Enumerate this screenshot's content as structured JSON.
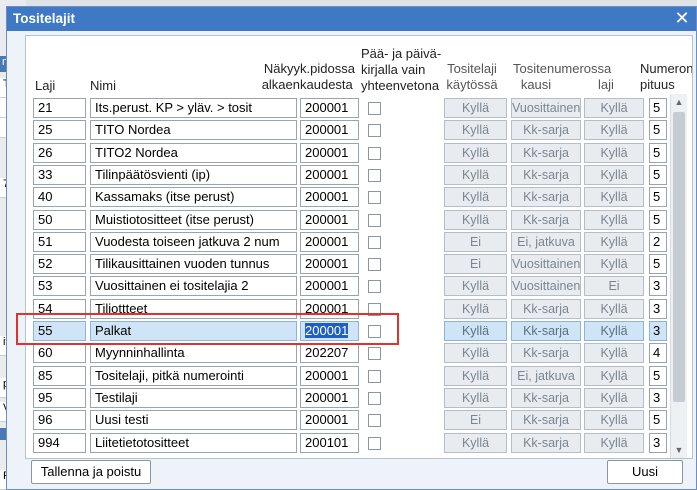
{
  "background": {
    "fragments": [
      "ma",
      "T",
      "7",
      "ito",
      "pä",
      "V",
      "Ra"
    ]
  },
  "dialog": {
    "title": "Tositelajit",
    "close_glyph": "✕"
  },
  "headers": {
    "laji": "Laji",
    "nimi": "Nimi",
    "nakyy": [
      "Näkyy",
      "alkaen"
    ],
    "kp": [
      "k.pidossa",
      "kaudesta"
    ],
    "paa": [
      "Pää- ja päivä-",
      "kirjalla vain",
      "yhteenvetona"
    ],
    "tositelaji": [
      "Tositelaji",
      "käytössä"
    ],
    "tositenumerossa": "Tositenumerossa",
    "kausi": "kausi",
    "laji2": "laji",
    "numeron": [
      "Numeron",
      "pituus"
    ]
  },
  "rows": [
    {
      "laji": "21",
      "nimi": "Its.perust. KP > yläv. > tosit",
      "kp": "200001",
      "kaytossa": "Kyllä",
      "kausi": "Vuosittainen",
      "laji2": "Kyllä",
      "pituus": "5"
    },
    {
      "laji": "25",
      "nimi": "TITO Nordea",
      "kp": "200001",
      "kaytossa": "Kyllä",
      "kausi": "Kk-sarja",
      "laji2": "Kyllä",
      "pituus": "5"
    },
    {
      "laji": "26",
      "nimi": "TITO2 Nordea",
      "kp": "200001",
      "kaytossa": "Kyllä",
      "kausi": "Kk-sarja",
      "laji2": "Kyllä",
      "pituus": "5"
    },
    {
      "laji": "33",
      "nimi": "Tilinpäätösvienti (ip)",
      "kp": "200001",
      "kaytossa": "Kyllä",
      "kausi": "Kk-sarja",
      "laji2": "Kyllä",
      "pituus": "5"
    },
    {
      "laji": "40",
      "nimi": "Kassamaks (itse perust)",
      "kp": "200001",
      "kaytossa": "Kyllä",
      "kausi": "Kk-sarja",
      "laji2": "Kyllä",
      "pituus": "5"
    },
    {
      "laji": "50",
      "nimi": "Muistiotositteet (itse perust)",
      "kp": "200001",
      "kaytossa": "Kyllä",
      "kausi": "Kk-sarja",
      "laji2": "Kyllä",
      "pituus": "5"
    },
    {
      "laji": "51",
      "nimi": "Vuodesta toiseen jatkuva 2 num",
      "kp": "200001",
      "kaytossa": "Ei",
      "kausi": "Ei, jatkuva",
      "laji2": "Kyllä",
      "pituus": "2"
    },
    {
      "laji": "52",
      "nimi": "Tilikausittainen vuoden tunnus",
      "kp": "200001",
      "kaytossa": "Ei",
      "kausi": "Vuosittainen",
      "laji2": "Kyllä",
      "pituus": "5"
    },
    {
      "laji": "53",
      "nimi": "Vuosittainen ei tositelajia 2",
      "kp": "200001",
      "kaytossa": "Kyllä",
      "kausi": "Vuosittainen",
      "laji2": "Ei",
      "pituus": "3"
    },
    {
      "laji": "54",
      "nimi": "Tiliottteet",
      "kp": "200001",
      "kaytossa": "Kyllä",
      "kausi": "Kk-sarja",
      "laji2": "Kyllä",
      "pituus": "3"
    },
    {
      "laji": "55",
      "nimi": "Palkat",
      "kp": "200001",
      "kaytossa": "Kyllä",
      "kausi": "Kk-sarja",
      "laji2": "Kyllä",
      "pituus": "3",
      "selected": true
    },
    {
      "laji": "60",
      "nimi": "Myynninhallinta",
      "kp": "202207",
      "kaytossa": "Kyllä",
      "kausi": "Kk-sarja",
      "laji2": "Kyllä",
      "pituus": "4"
    },
    {
      "laji": "85",
      "nimi": "Tositelaji, pitkä numerointi",
      "kp": "200001",
      "kaytossa": "Kyllä",
      "kausi": "Ei, jatkuva",
      "laji2": "Kyllä",
      "pituus": "5"
    },
    {
      "laji": "95",
      "nimi": "Testilaji",
      "kp": "200001",
      "kaytossa": "Kyllä",
      "kausi": "Kk-sarja",
      "laji2": "Kyllä",
      "pituus": "3"
    },
    {
      "laji": "96",
      "nimi": "Uusi testi",
      "kp": "200001",
      "kaytossa": "Ei",
      "kausi": "Kk-sarja",
      "laji2": "Kyllä",
      "pituus": "5"
    },
    {
      "laji": "994",
      "nimi": "Liitetietotositteet",
      "kp": "200101",
      "kaytossa": "Kyllä",
      "kausi": "Kk-sarja",
      "laji2": "Kyllä",
      "pituus": "3"
    }
  ],
  "footer": {
    "save_label": "Tallenna ja poistu",
    "new_label": "Uusi"
  },
  "colors": {
    "titlebar": "#3f78c4",
    "selection": "#cfe4f7",
    "highlight": "#e0332b"
  }
}
